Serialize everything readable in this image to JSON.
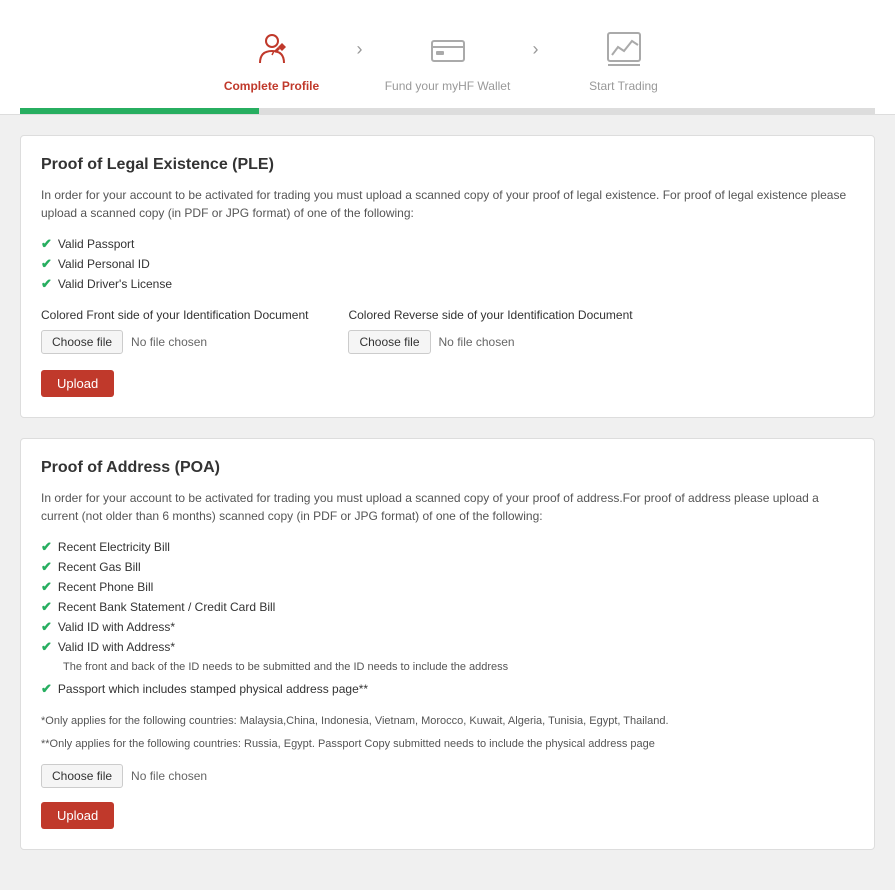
{
  "steps": [
    {
      "id": "complete-profile",
      "label": "Complete Profile",
      "active": true,
      "icon": "profile-edit"
    },
    {
      "id": "fund-wallet",
      "label": "Fund your myHF Wallet",
      "active": false,
      "icon": "wallet"
    },
    {
      "id": "start-trading",
      "label": "Start Trading",
      "active": false,
      "icon": "chart"
    }
  ],
  "progress_percent": 28,
  "ple_section": {
    "title": "Proof of Legal Existence (PLE)",
    "description": "In order for your account to be activated for trading you must upload a scanned copy of your proof of legal existence. For proof of legal existence please upload a scanned copy (in PDF or JPG format) of one of the following:",
    "checklist": [
      "Valid Passport",
      "Valid Personal ID",
      "Valid Driver's License"
    ],
    "front_label": "Colored Front side of your Identification Document",
    "back_label": "Colored Reverse side of your Identification Document",
    "no_file_text": "No file chosen",
    "choose_file_label": "Choose file",
    "upload_label": "Upload"
  },
  "poa_section": {
    "title": "Proof of Address (POA)",
    "description": "In order for your account to be activated for trading you must upload a scanned copy of your proof of address.For proof of address please upload a current (not older than 6 months) scanned copy (in PDF or JPG format) of one of the following:",
    "checklist": [
      "Recent Electricity Bill",
      "Recent Gas Bill",
      "Recent Phone Bill",
      "Recent Bank Statement / Credit Card Bill",
      "Valid ID with Address*",
      "Passport which includes stamped physical address page**"
    ],
    "sub_note": "The front and back of the ID needs to be submitted and the ID needs to include the address",
    "footnote1": "*Only applies for the following countries: Malaysia,China, Indonesia, Vietnam, Morocco, Kuwait, Algeria, Tunisia, Egypt, Thailand.",
    "footnote2": "**Only applies for the following countries: Russia, Egypt. Passport Copy submitted needs to include the physical address page",
    "no_file_text": "No file chosen",
    "choose_file_label": "Choose file",
    "upload_label": "Upload"
  }
}
